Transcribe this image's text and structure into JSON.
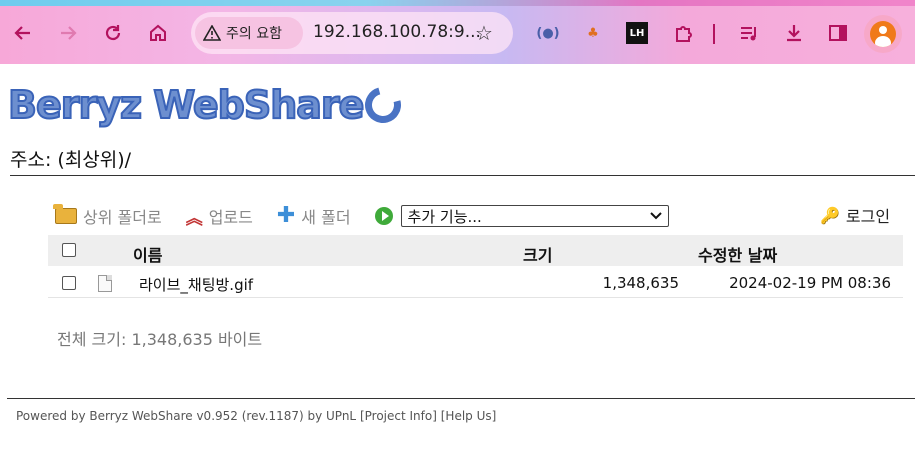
{
  "browser": {
    "back_icon": "arrow-left-icon",
    "forward_icon": "arrow-right-icon",
    "reload_icon": "reload-icon",
    "home_icon": "home-icon",
    "security_label": "주의 요함",
    "url": "192.168.100.78:9...",
    "accent_color": "#b3125e"
  },
  "page": {
    "logo_text": "Berryz WebShare",
    "path_label": "주소: (최상위)/"
  },
  "actions": {
    "parent_folder": "상위 폴더로",
    "upload": "업로드",
    "new_folder": "새 폴더",
    "more_select_value": "추가 기능...",
    "login": "로그인"
  },
  "table": {
    "headers": {
      "name": "이름",
      "size": "크기",
      "modified": "수정한 날짜"
    },
    "rows": [
      {
        "name": "라이브_채팅방.gif",
        "size": "1,348,635",
        "modified": "2024-02-19 PM 08:36"
      }
    ]
  },
  "summary": {
    "total": "전체 크기: 1,348,635 바이트"
  },
  "footer": {
    "text": "Powered by Berryz WebShare v0.952 (rev.1187) by UPnL",
    "project_info": "[Project Info]",
    "help": "[Help Us]"
  }
}
